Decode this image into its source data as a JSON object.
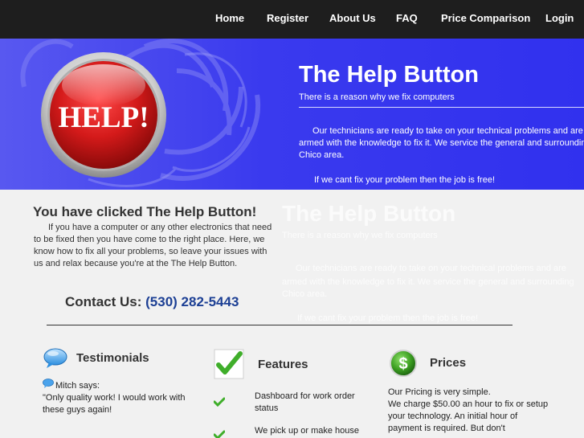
{
  "nav": {
    "items": [
      "Home",
      "Register",
      "About Us",
      "FAQ",
      "Price Comparison",
      "Login"
    ]
  },
  "hero": {
    "button_text": "HELP!",
    "title": "The Help Button",
    "subtitle": "There is a reason why we fix computers",
    "paragraph": "Our technicians are ready to take on your technical problems and are armed with the knowledge to fix it. We service the general and surrounding Chico area.",
    "free_line": "If we cant fix your problem then the job is free!"
  },
  "ghost": {
    "title": "The Help Button",
    "subtitle": "There is a reason why we fix computers",
    "p_line1": "Our technicians are ready to take on your technical problems and are",
    "p_line2": "armed with the knowledge to fix it. We service the general and surrounding",
    "p_line3": "Chico area.",
    "free_line": "If we cant fix your problem then the job is free!"
  },
  "main": {
    "title": "You have clicked The Help Button!",
    "paragraph": "If you have a computer or any other electronics that need to be fixed then you have come to the right place. Here, we know how to fix all your problems, so leave your issues with us and relax because you're at the The Help Button.",
    "contact_label": "Contact Us:",
    "contact_phone": "(530) 282-5443"
  },
  "testimonials": {
    "title": "Testimonials",
    "author": "Mitch says:",
    "quote": "\"Only quality work! I would work with these guys again!"
  },
  "features": {
    "title": "Features",
    "item1": "Dashboard for work order status",
    "item2": "We pick up or make house"
  },
  "prices": {
    "title": "Prices",
    "line1": "Our Pricing is very simple.",
    "line2": "We charge $50.00 an hour to fix or setup your technology. An initial hour of payment is required. But don't"
  },
  "colors": {
    "nav_bg": "#1e1e1e",
    "hero_blue": "#3a3aee",
    "phone_blue": "#1c3f94",
    "help_red": "#d41a1a"
  }
}
